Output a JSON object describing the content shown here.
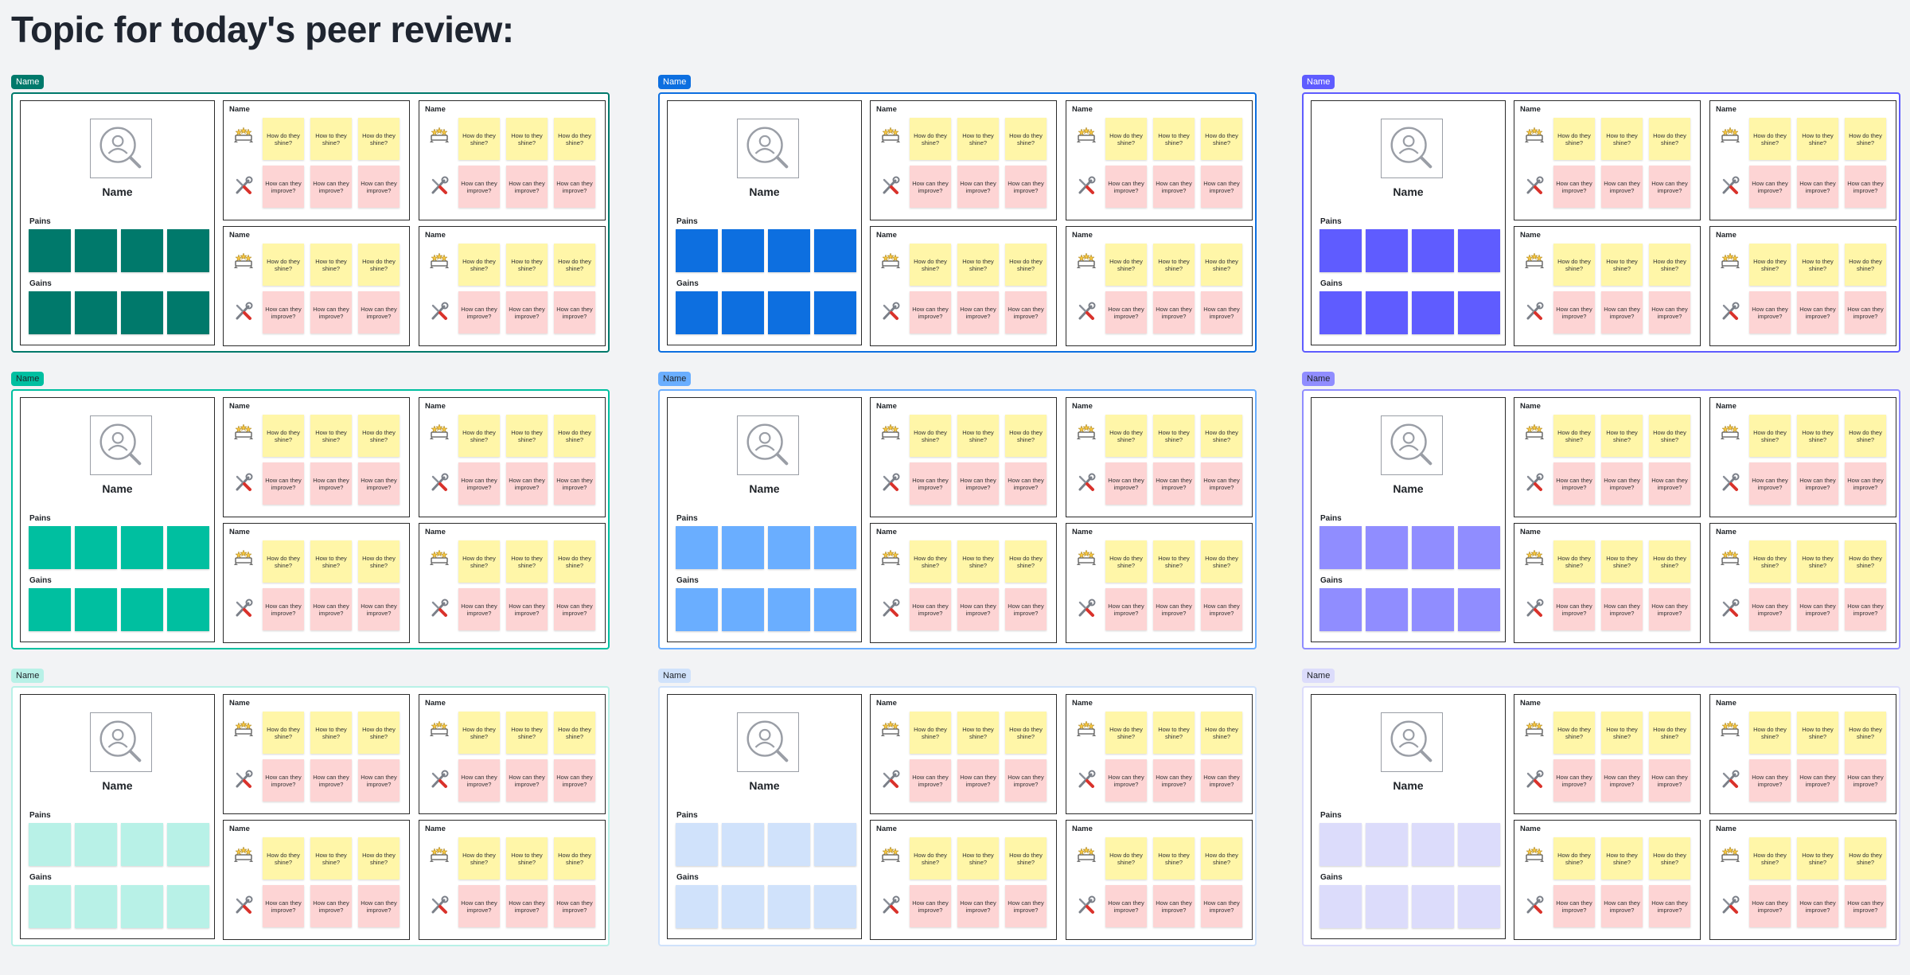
{
  "page": {
    "title": "Topic for today's peer review:"
  },
  "frame_defaults": {
    "tag_label": "Name",
    "person_name": "Name",
    "pains_label": "Pains",
    "gains_label": "Gains",
    "reviewer_name": "Name",
    "shine_notes": [
      "How do they shine?",
      "How to they shine?",
      "How do they shine?"
    ],
    "improve_notes": [
      "How can they improve?",
      "How can they improve?",
      "How can they improve?"
    ],
    "pains_count": 4,
    "gains_count": 4
  },
  "frames": [
    {
      "tag": "Name",
      "tag_bg": "#00796b",
      "tag_fg": "#ffffff",
      "border": "#00796b",
      "sticky": "#00796b"
    },
    {
      "tag": "Name",
      "tag_bg": "#0d6fe0",
      "tag_fg": "#ffffff",
      "border": "#0d6fe0",
      "sticky": "#0d6fe0"
    },
    {
      "tag": "Name",
      "tag_bg": "#5f5cff",
      "tag_fg": "#ffffff",
      "border": "#5f5cff",
      "sticky": "#5f5cff"
    },
    {
      "tag": "Name",
      "tag_bg": "#00bfa0",
      "tag_fg": "#1f2328",
      "border": "#00bfa0",
      "sticky": "#00bfa0"
    },
    {
      "tag": "Name",
      "tag_bg": "#6aaeff",
      "tag_fg": "#1f2328",
      "border": "#6aaeff",
      "sticky": "#6aaeff"
    },
    {
      "tag": "Name",
      "tag_bg": "#908dff",
      "tag_fg": "#1f2328",
      "border": "#908dff",
      "sticky": "#908dff"
    },
    {
      "tag": "Name",
      "tag_bg": "#b8f1e7",
      "tag_fg": "#1f2328",
      "border": "#b8f1e7",
      "sticky": "#b8f1e7"
    },
    {
      "tag": "Name",
      "tag_bg": "#d0e2fb",
      "tag_fg": "#1f2328",
      "border": "#d0e2fb",
      "sticky": "#d0e2fb"
    },
    {
      "tag": "Name",
      "tag_bg": "#dcdcfb",
      "tag_fg": "#1f2328",
      "border": "#dcdcfb",
      "sticky": "#dcdcfb"
    }
  ],
  "colors": {
    "shine_note": "#fff6a8",
    "improve_note": "#fdd4d4",
    "canvas_bg": "#f2f3f5"
  },
  "icons": {
    "avatar": "person-search-icon",
    "shine": "stars-ribbon-icon",
    "improve": "tools-icon"
  }
}
